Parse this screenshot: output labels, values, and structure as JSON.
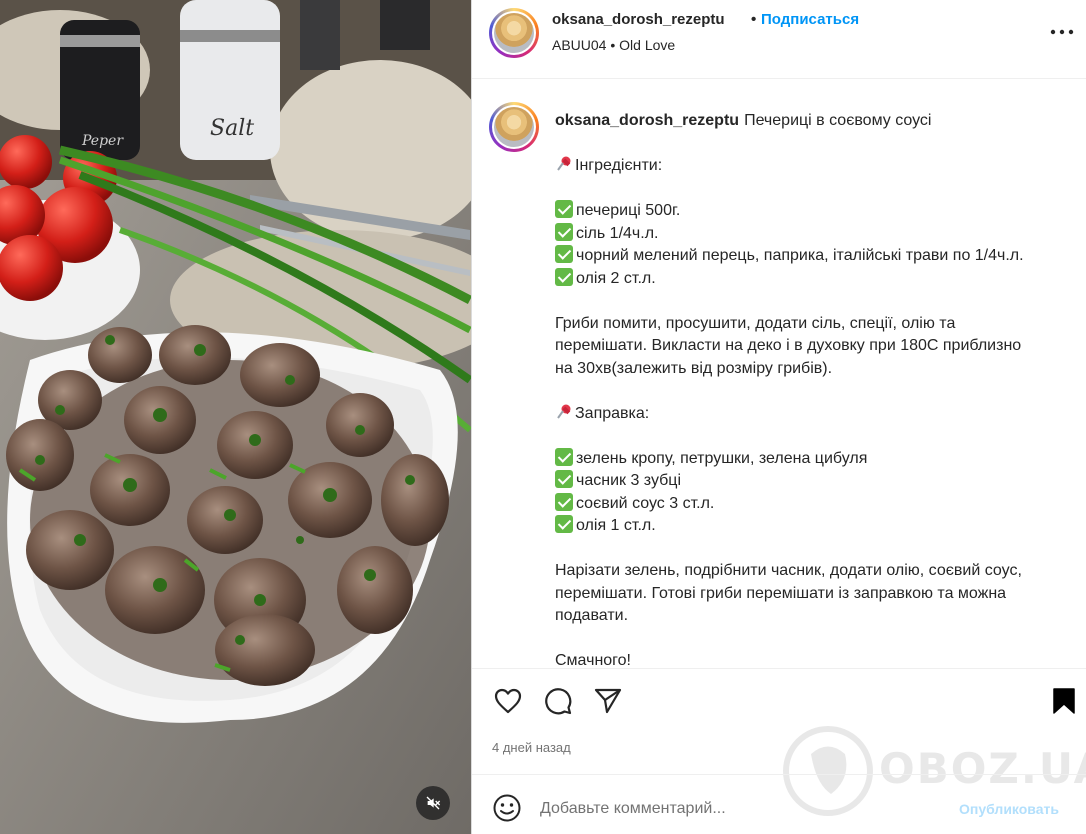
{
  "header": {
    "username": "oksana_dorosh_rezeptu",
    "separator": "•",
    "follow_label": "Подписаться",
    "audio": "ABUU04 • Old Love"
  },
  "caption": {
    "username": "oksana_dorosh_rezeptu",
    "title": "Печериці в соєвому соусі",
    "ingredients_heading": "Інгредієнти:",
    "ingredients": [
      "печериці 500г.",
      "сіль 1/4ч.л.",
      "чорний мелений перець, паприка, італійські трави по 1/4ч.л.",
      "олія 2 ст.л."
    ],
    "step1_line1": "Гриби помити, просушити, додати сіль, спеції, олію та",
    "step1_line2": "перемішати. Викласти на деко і в духовку при 180С приблизно",
    "step1_line3": "на 30хв(залежить від розміру грибів).",
    "dressing_heading": "Заправка:",
    "dressing": [
      "зелень кропу, петрушки, зелена цибуля",
      "часник 3 зубці",
      "соєвий соус 3 ст.л.",
      "олія 1 ст.л."
    ],
    "step2_line1": "Нарізати зелень, подрібнити часник, додати олію, соєвий соус,",
    "step2_line2": "перемішати. Готові гриби перемішати із заправкою та можна",
    "step2_line3": "подавати.",
    "closing": "Смачного!"
  },
  "post": {
    "time_ago": "4 дней назад"
  },
  "comment": {
    "placeholder": "Добавьте комментарий...",
    "publish_label": "Опубликовать"
  },
  "media": {
    "salt_label": "Salt",
    "pepper_label": "Peper"
  },
  "watermark": {
    "text": "OBOZ.UA"
  },
  "icons": {
    "more": "more-horizontal-icon",
    "like": "heart-icon",
    "comment": "comment-bubble-icon",
    "share": "paper-plane-icon",
    "save": "bookmark-icon",
    "emoji": "smiley-icon",
    "mute": "speaker-muted-icon",
    "check": "check-mark-emoji",
    "pin": "pushpin-emoji"
  },
  "colors": {
    "link_blue": "#0095f6",
    "publish_disabled": "#b2dffc",
    "check_green": "#63b946",
    "pin_red": "#e2374a"
  }
}
